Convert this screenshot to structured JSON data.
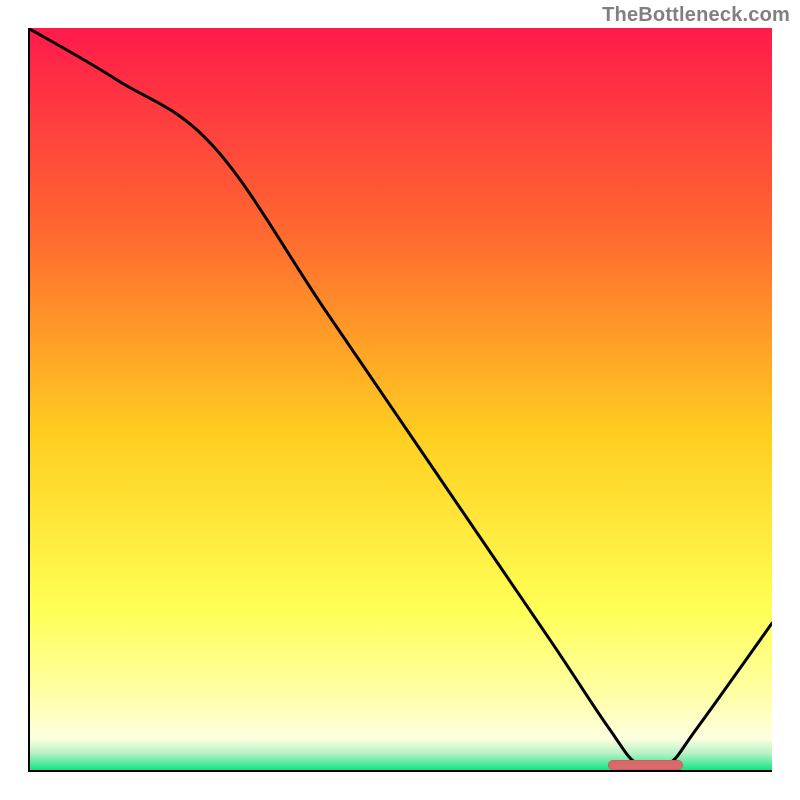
{
  "attribution": "TheBottleneck.com",
  "colors": {
    "gradient_top": "#ff1a4b",
    "gradient_mid_upper": "#ff8a2a",
    "gradient_mid": "#ffd21f",
    "gradient_lower": "#ffff66",
    "gradient_pale": "#ffffcc",
    "gradient_bottom": "#00e27a",
    "axis": "#000000",
    "curve": "#000000",
    "marker": "#d96a6a"
  },
  "chart_data": {
    "type": "line",
    "title": "",
    "xlabel": "",
    "ylabel": "",
    "x_range": [
      0,
      100
    ],
    "y_range": [
      0,
      100
    ],
    "series": [
      {
        "name": "bottleneck-curve",
        "x": [
          0,
          12,
          25,
          40,
          55,
          70,
          78,
          82,
          86,
          90,
          100
        ],
        "y": [
          100,
          93,
          84,
          62,
          40,
          18,
          6,
          1,
          1,
          6,
          20
        ]
      }
    ],
    "optimal_range": {
      "x_start": 78,
      "x_end": 88,
      "y": 1
    },
    "gradient_stops": [
      {
        "pos": 0.0,
        "color": "#ff1a4b"
      },
      {
        "pos": 0.28,
        "color": "#ff6a2f"
      },
      {
        "pos": 0.55,
        "color": "#ffcf20"
      },
      {
        "pos": 0.78,
        "color": "#ffff55"
      },
      {
        "pos": 0.9,
        "color": "#ffffaa"
      },
      {
        "pos": 0.955,
        "color": "#fdffe0"
      },
      {
        "pos": 0.975,
        "color": "#b8f2c4"
      },
      {
        "pos": 1.0,
        "color": "#00e27a"
      }
    ]
  }
}
